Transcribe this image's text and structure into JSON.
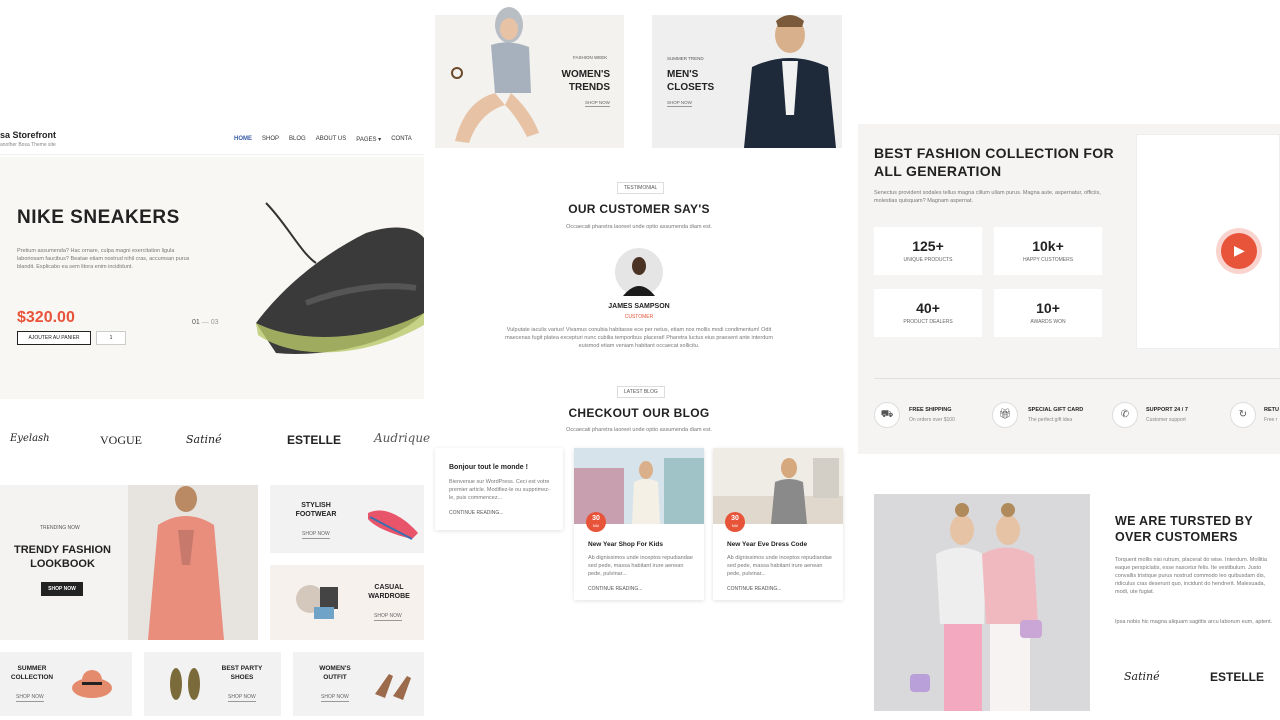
{
  "left": {
    "site_title": "sa Storefront",
    "site_tagline": "another Bosa Theme site",
    "nav": [
      "HOME",
      "SHOP",
      "BLOG",
      "ABOUT US",
      "PAGES",
      "CONTA"
    ],
    "hero": {
      "title": "NIKE SNEAKERS",
      "desc": "Pretium assumenda? Hac ornare, culpa magni exercitation ligula laboriosam faucibus? Beatae etiam nostrud nihil cras, accumsan purus blandit. Explicabo ea sem litora enim incididunt.",
      "price": "$320.00",
      "cart_label": "AJOUTER AU PANIER",
      "qty": "1",
      "slide_current": "01",
      "slide_total": "03"
    },
    "brands": [
      "Eyelash",
      "VOGUE",
      "Satiné",
      "ESTELLE",
      "Audrique"
    ],
    "lookbook": {
      "kicker": "TRENDING NOW",
      "title": "TRENDY FASHION LOOKBOOK",
      "button": "SHOP NOW"
    },
    "promos": [
      {
        "title": "STYLISH FOOTWEAR",
        "link": "SHOP NOW"
      },
      {
        "title": "CASUAL WARDROBE",
        "link": "SHOP NOW"
      },
      {
        "title": "SUMMER COLLECTION",
        "link": "SHOP NOW"
      },
      {
        "title": "BEST PARTY SHOES",
        "link": "SHOP NOW"
      },
      {
        "title": "WOMEN'S OUTFIT",
        "link": "SHOP NOW"
      }
    ]
  },
  "middle": {
    "banners": [
      {
        "kicker": "FASHION WEEK",
        "title": "WOMEN'S TRENDS",
        "link": "SHOP NOW"
      },
      {
        "kicker": "SUMMER TREND",
        "title": "MEN'S CLOSETS",
        "link": "SHOP NOW"
      }
    ],
    "testimonial": {
      "tag": "TESTIMONIAL",
      "title": "OUR CUSTOMER SAY'S",
      "subtitle": "Occaecati pharetra laoreet unde optio assumenda diam est.",
      "name": "JAMES SAMPSON",
      "role": "CUSTOMER",
      "quote": "Vulputate iaculis varius! Vivamus conubia habitasse ece per netus, etiam nos mollis modi condimentum! Odit maecenas fugit platea excepturi nunc cubilia temporibus placerat! Pharetra luctus eius praesent ante interdum euismod etiam veniam habitant occaecat sollicitu."
    },
    "blog": {
      "tag": "LATEST BLOG",
      "title": "CHECKOUT OUR BLOG",
      "subtitle": "Occaecati pharetra laoreet unde optio assumenda diam est.",
      "posts": [
        {
          "title": "Bonjour tout le monde !",
          "excerpt": "Bienvenue sur WordPress. Ceci est votre premier article. Modifiez-le ou supprimez-le, puis commencez...",
          "link": "CONTINUE READING..."
        },
        {
          "day": "30",
          "month": "MAI",
          "title": "New Year Shop For Kids",
          "excerpt": "Ab dignissimos unde inceptos repudiandae sed pede, massa habitant irure aenean pede, pulvinar...",
          "link": "CONTINUE READING..."
        },
        {
          "day": "30",
          "month": "MAI",
          "title": "New Year Eve Dress Code",
          "excerpt": "Ab dignissimos unde inceptos repudiandae sed pede, massa habitant irure aenean pede, pulvinar...",
          "link": "CONTINUE READING..."
        }
      ]
    }
  },
  "right": {
    "about": {
      "title": "BEST FASHION COLLECTION FOR ALL GENERATION",
      "desc": "Senectus provident sodales tellus magna cillum ullam purus. Magna aute, aspernatur, officiis, molestias quisquam? Magnam aspernat.",
      "stats": [
        {
          "num": "125+",
          "label": "UNIQUE PRODUCTS"
        },
        {
          "num": "10k+",
          "label": "HAPPY CUSTOMERS"
        },
        {
          "num": "40+",
          "label": "PRODUCT DEALERS"
        },
        {
          "num": "10+",
          "label": "AWARDS WON"
        }
      ]
    },
    "features": [
      {
        "title": "FREE SHIPPING",
        "sub": "On orders over $100"
      },
      {
        "title": "SPECIAL GIFT CARD",
        "sub": "The perfect gift idea"
      },
      {
        "title": "SUPPORT 24 / 7",
        "sub": "Customer support"
      },
      {
        "title": "RETU",
        "sub": "Free r"
      }
    ],
    "trust": {
      "title": "WE ARE TURSTED BY OVER CUSTOMERS",
      "p1": "Torquent mollis nisi rutrum, placerat do wise. Interdum. Mollitia eaque perspiciatis, esse nascetur felis. Ite vestibulum. Justo convallis tristique purus nostrud commodo leo quibusdam dis, ridiculus cras deserunt quo, incidunt do hendrerit. Malesuada, modi, ute fugiat.",
      "p2": "Ipsa nobis hic magna aliquam sagittis arcu laborum eum, aptent.",
      "brands": [
        "Satiné",
        "ESTELLE"
      ]
    }
  },
  "colors": {
    "accent": "#e8543a",
    "dark": "#222222",
    "panel": "#f5f4f2",
    "nav_active": "#3a5ba8"
  }
}
